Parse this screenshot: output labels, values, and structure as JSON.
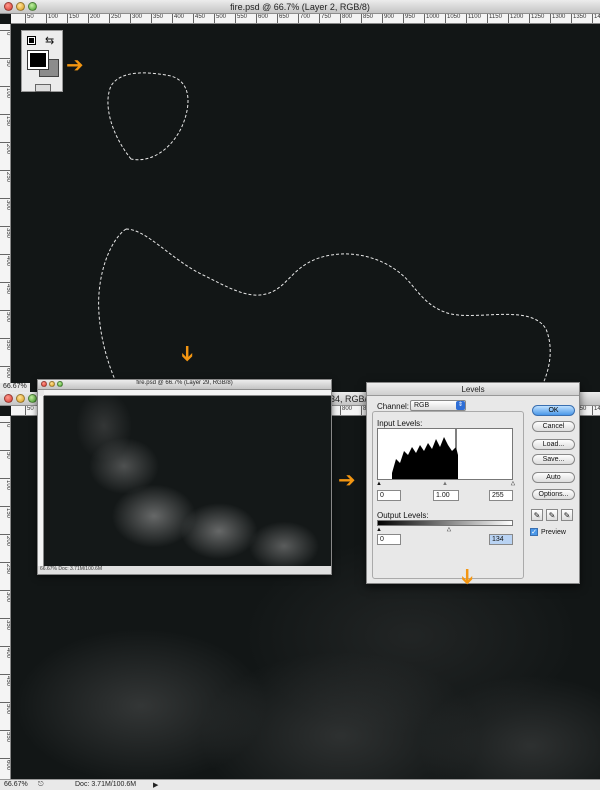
{
  "top_window": {
    "title": "fire.psd @ 66.7% (Layer 2, RGB/8)",
    "zoom": "66.67%",
    "ruler_ticks": [
      "50",
      "100",
      "150",
      "200",
      "250",
      "300",
      "350",
      "400",
      "450",
      "500",
      "550",
      "600",
      "650",
      "700",
      "750",
      "800",
      "850",
      "900",
      "950",
      "1000",
      "1050",
      "1100",
      "1150",
      "1200",
      "1250",
      "1300",
      "1350",
      "1400"
    ],
    "ruler_v_ticks": [
      "0",
      "50",
      "100",
      "150",
      "200",
      "250",
      "300",
      "350",
      "400",
      "450",
      "500",
      "550",
      "600",
      "650"
    ]
  },
  "swatches": {
    "foreground_color": "#000000",
    "background_color": "#8c8c8c"
  },
  "bottom_window": {
    "title_fragment": "34, RGB/8)",
    "zoom": "66.67%",
    "doc_info": "Doc: 3.71M/100.6M"
  },
  "small_window": {
    "title": "fire.psd @ 66.7% (Layer 29, RGB/8)",
    "status": "66.67%    Doc: 3.71M/100.6M"
  },
  "levels": {
    "title": "Levels",
    "channel_label": "Channel:",
    "channel_value": "RGB",
    "input_label": "Input Levels:",
    "input_black": "0",
    "input_gamma": "1.00",
    "input_white": "255",
    "output_label": "Output Levels:",
    "output_black": "0",
    "output_white": "134",
    "buttons": {
      "ok": "OK",
      "cancel": "Cancel",
      "load": "Load...",
      "save": "Save...",
      "auto": "Auto",
      "options": "Options..."
    },
    "preview_label": "Preview",
    "preview_checked": true
  },
  "annotations": {
    "arrow_color": "#f39612",
    "icon": "orange-arrow-icon"
  }
}
